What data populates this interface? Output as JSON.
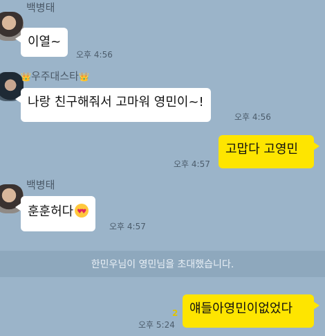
{
  "messages": [
    {
      "sender": "백병태",
      "text": "이열~",
      "time": "오후 4:56"
    },
    {
      "sender_prefix": "👑",
      "sender": "우주대스타",
      "sender_suffix": "👑",
      "text": "나랑 친구해줘서 고마워 영민이~!",
      "time": "오후 4:56"
    },
    {
      "text": "고맙다 고영민",
      "time": "오후 4:57"
    },
    {
      "sender": "백병태",
      "text": "훈훈허다",
      "emoji": "smiling-face-with-heart-eyes",
      "time": "오후 4:57"
    },
    {
      "text": "얘들아영민이없었다",
      "time": "오후 5:24",
      "unread": "2"
    }
  ],
  "system_notice": "한민우님이 영민님을 초대했습니다.",
  "colors": {
    "background": "#9bb4c9",
    "my_bubble": "#fee500",
    "other_bubble": "#ffffff",
    "notice_bar": "#8ea8bd"
  }
}
